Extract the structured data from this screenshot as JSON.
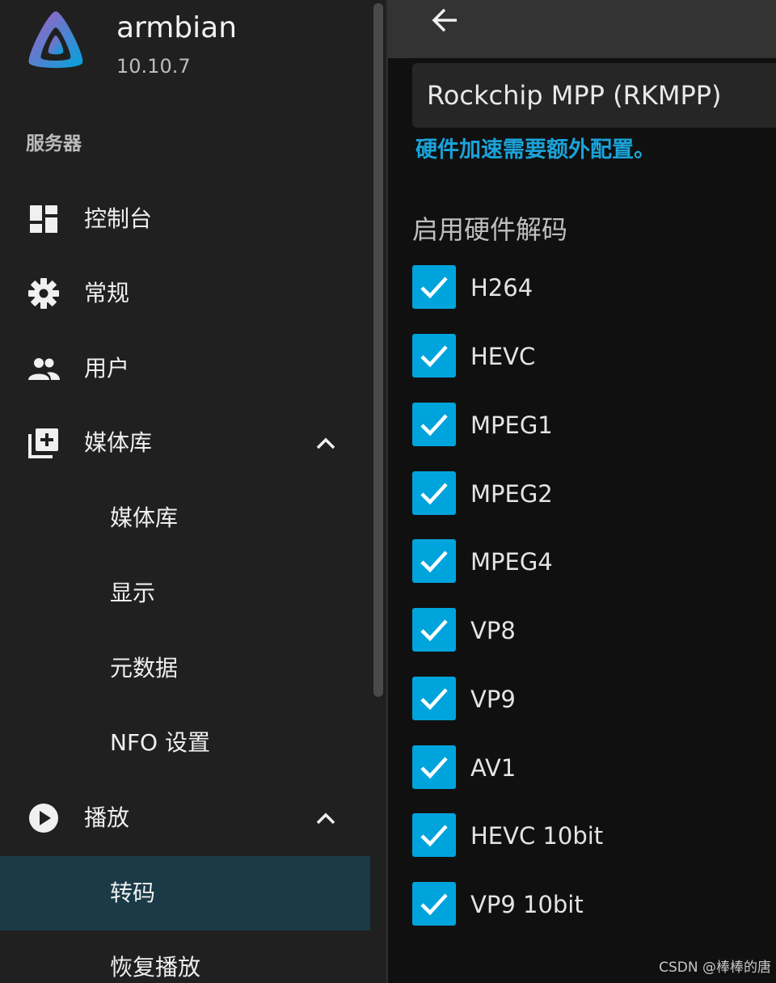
{
  "brand": {
    "name": "armbian",
    "version": "10.10.7"
  },
  "sidebar": {
    "section_header": "服务器",
    "items": [
      {
        "label": "控制台",
        "icon": "dashboard-icon"
      },
      {
        "label": "常规",
        "icon": "gear-icon"
      },
      {
        "label": "用户",
        "icon": "people-icon"
      },
      {
        "label": "媒体库",
        "icon": "library-add-icon",
        "expanded": true
      },
      {
        "label": "媒体库"
      },
      {
        "label": "显示"
      },
      {
        "label": "元数据"
      },
      {
        "label": "NFO 设置"
      },
      {
        "label": "播放",
        "icon": "play-circle-icon",
        "expanded": true
      },
      {
        "label": "转码",
        "active": true
      },
      {
        "label": "恢复播放"
      }
    ]
  },
  "topbar": {
    "back_icon": "arrow-left-icon"
  },
  "transcoding": {
    "hw_accel_selected": "Rockchip MPP (RKMPP)",
    "hw_accel_note": "硬件加速需要额外配置。",
    "decode_heading": "启用硬件解码",
    "codecs": [
      {
        "label": "H264",
        "checked": true
      },
      {
        "label": "HEVC",
        "checked": true
      },
      {
        "label": "MPEG1",
        "checked": true
      },
      {
        "label": "MPEG2",
        "checked": true
      },
      {
        "label": "MPEG4",
        "checked": true
      },
      {
        "label": "VP8",
        "checked": true
      },
      {
        "label": "VP9",
        "checked": true
      },
      {
        "label": "AV1",
        "checked": true
      },
      {
        "label": "HEVC 10bit",
        "checked": true
      },
      {
        "label": "VP9 10bit",
        "checked": true
      }
    ]
  },
  "watermark": "CSDN @棒棒的唐",
  "colors": {
    "accent": "#00a4dc",
    "note_blue": "#1aa3d9",
    "active_item_bg": "#1a3a47",
    "sidebar_bg": "#202020",
    "main_bg": "#101010"
  }
}
